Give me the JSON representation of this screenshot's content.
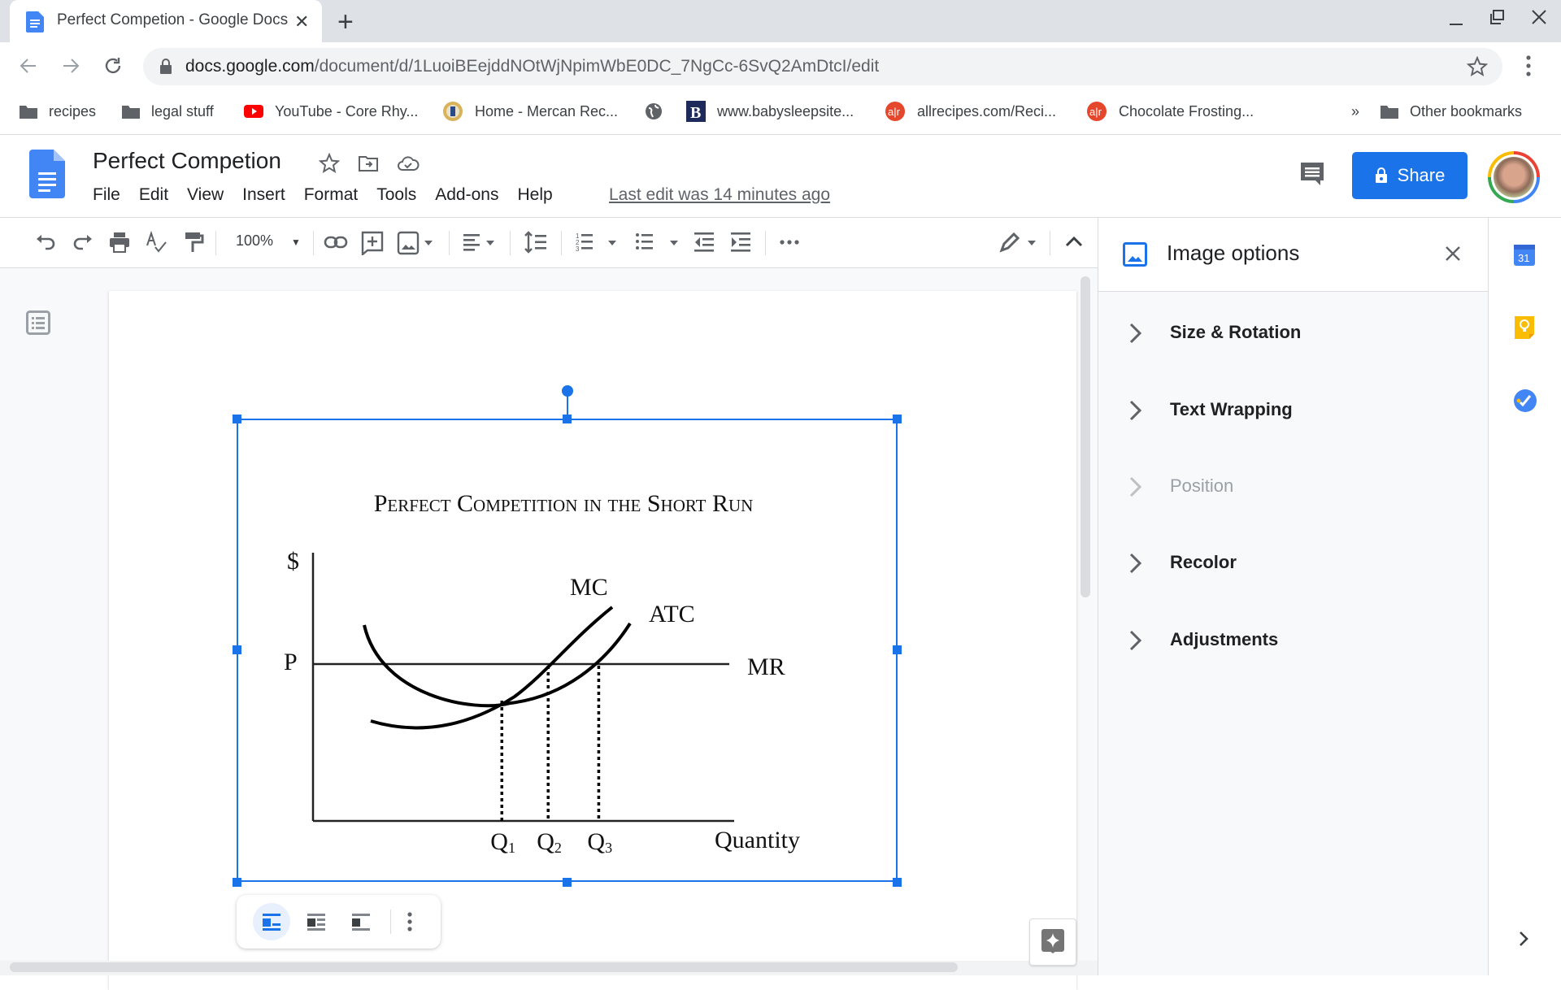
{
  "browser": {
    "tab_title": "Perfect Competion - Google Docs",
    "url_host": "docs.google.com",
    "url_path": "/document/d/1LuoiBEejddNOtWjNpimWbE0DC_7NgCc-6SvQ2AmDtcI/edit",
    "bookmarks": [
      {
        "label": "recipes",
        "icon": "folder-icon"
      },
      {
        "label": "legal stuff",
        "icon": "folder-icon"
      },
      {
        "label": "YouTube - Core Rhy...",
        "icon": "youtube-icon"
      },
      {
        "label": "Home - Mercan Rec...",
        "icon": "mercan-icon"
      },
      {
        "label": "",
        "icon": "globe-icon"
      },
      {
        "label": "www.babysleepsite...",
        "icon": "b-icon"
      },
      {
        "label": "allrecipes.com/Reci...",
        "icon": "allrecipes-icon"
      },
      {
        "label": "Chocolate Frosting...",
        "icon": "allrecipes-icon"
      }
    ],
    "overflow_label": "»",
    "other_bookmarks": "Other bookmarks"
  },
  "doc": {
    "title": "Perfect Competion",
    "menus": [
      "File",
      "Edit",
      "View",
      "Insert",
      "Format",
      "Tools",
      "Add-ons",
      "Help"
    ],
    "last_edit": "Last edit was 14 minutes ago",
    "share_label": "Share",
    "zoom": "100%"
  },
  "colors": {
    "accent": "#1a73e8",
    "tab_strip": "#dee1e6",
    "panel_bg": "#f8f9fa"
  },
  "side_panel": {
    "title": "Image options",
    "items": [
      {
        "label": "Size & Rotation",
        "enabled": true
      },
      {
        "label": "Text Wrapping",
        "enabled": true
      },
      {
        "label": "Position",
        "enabled": false
      },
      {
        "label": "Recolor",
        "enabled": true
      },
      {
        "label": "Adjustments",
        "enabled": true
      }
    ]
  },
  "image_toolbar": {
    "wrap_modes": [
      "In line",
      "Wrap text",
      "Break text"
    ],
    "active_mode": "In line"
  },
  "chart_data": {
    "type": "line",
    "title": "Perfect Competition in the Short Run",
    "ylabel": "$",
    "xlabel": "Quantity",
    "price_label": "P",
    "series": [
      {
        "name": "MC",
        "shape": "rising convex curve",
        "points": [
          [
            0.15,
            0.18
          ],
          [
            0.45,
            0.32
          ],
          [
            0.58,
            0.44
          ],
          [
            0.68,
            0.58
          ],
          [
            0.72,
            0.65
          ],
          [
            0.76,
            0.8
          ]
        ]
      },
      {
        "name": "ATC",
        "shape": "U-shaped curve",
        "points": [
          [
            0.12,
            0.72
          ],
          [
            0.25,
            0.5
          ],
          [
            0.45,
            0.32
          ],
          [
            0.58,
            0.34
          ],
          [
            0.68,
            0.44
          ],
          [
            0.8,
            0.78
          ]
        ]
      },
      {
        "name": "MR",
        "shape": "horizontal line at P",
        "points": [
          [
            0,
            0.5
          ],
          [
            1,
            0.5
          ]
        ]
      }
    ],
    "x_ticks": [
      "Q1",
      "Q2",
      "Q3"
    ],
    "x_tick_positions": [
      0.46,
      0.57,
      0.69
    ],
    "annotations": [
      "MC",
      "ATC",
      "MR"
    ],
    "notes": "Q1 at MC–ATC intersection (min ATC); Q2 at MC=MR; Q3 at ATC=MR. Dotted vertical lines from intersections to quantity axis.",
    "grid": false
  }
}
